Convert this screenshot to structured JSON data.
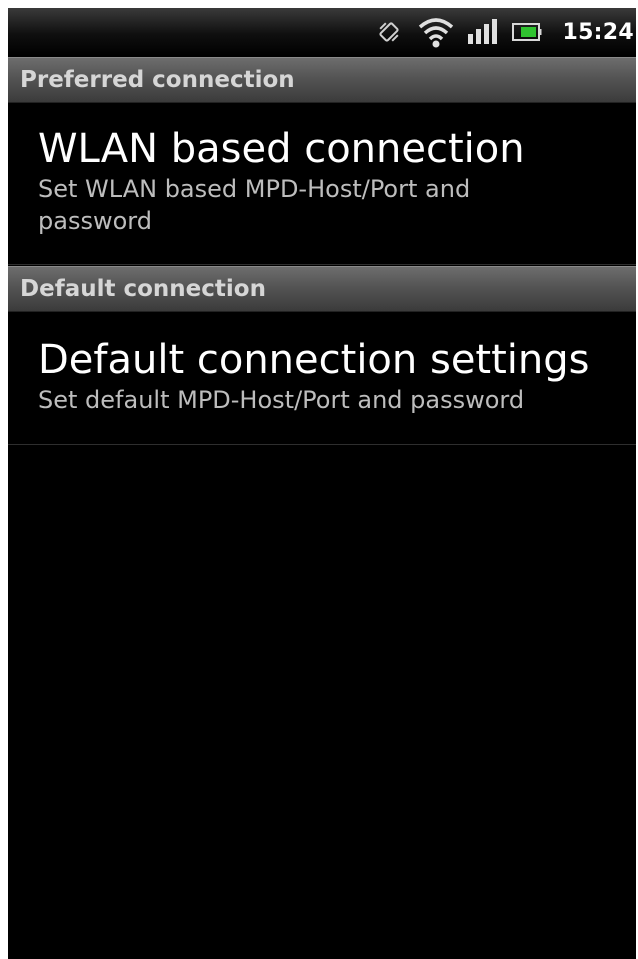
{
  "status_bar": {
    "time": "15:24",
    "icons": [
      "vibrate-icon",
      "wifi-icon",
      "signal-icon",
      "battery-icon"
    ]
  },
  "sections": [
    {
      "header": "Preferred connection",
      "items": [
        {
          "title": "WLAN based connection",
          "summary": "Set WLAN based MPD-Host/Port and password"
        }
      ]
    },
    {
      "header": "Default connection",
      "items": [
        {
          "title": "Default connection settings",
          "summary": "Set default MPD-Host/Port and password"
        }
      ]
    }
  ],
  "colors": {
    "background": "#000000",
    "header_text": "#d6d6d6",
    "title_text": "#ffffff",
    "summary_text": "#bdbdbd"
  }
}
